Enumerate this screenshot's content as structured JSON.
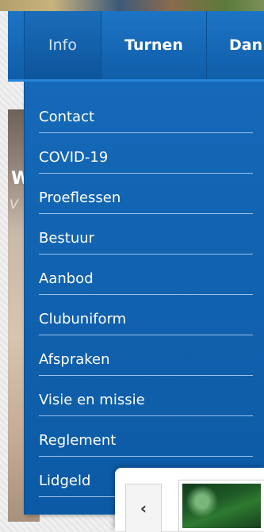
{
  "nav": {
    "items": [
      {
        "label": "Info"
      },
      {
        "label": "Turnen"
      },
      {
        "label": "Dan"
      }
    ]
  },
  "background": {
    "heading_fragment": "W",
    "subheading_fragment": "V"
  },
  "dropdown": {
    "items": [
      {
        "label": "Contact"
      },
      {
        "label": "COVID-19"
      },
      {
        "label": "Proeflessen"
      },
      {
        "label": "Bestuur"
      },
      {
        "label": "Aanbod"
      },
      {
        "label": "Clubuniform"
      },
      {
        "label": "Afspraken"
      },
      {
        "label": "Visie en missie"
      },
      {
        "label": "Reglement"
      },
      {
        "label": "Lidgeld"
      }
    ]
  },
  "slider": {
    "prev_glyph": "‹",
    "prev_icon": "chevron-left-icon"
  }
}
